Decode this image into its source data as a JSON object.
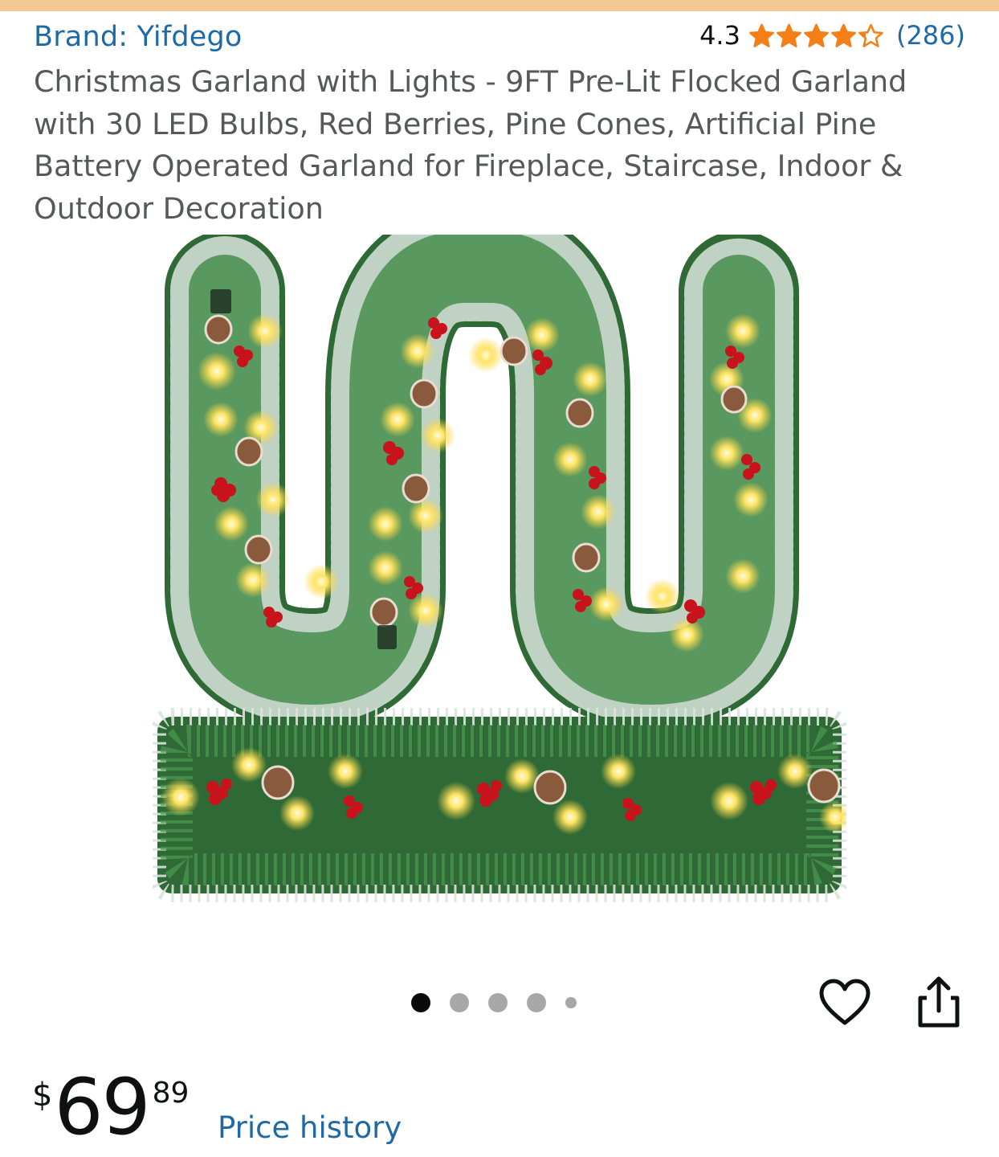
{
  "colors": {
    "link": "#1f6aa5",
    "title_text": "#565959",
    "star": "#f57f17",
    "top_bar": "#f3c892",
    "dot_active": "#0a0a0a",
    "dot_inactive": "#a7a7a7"
  },
  "product": {
    "brand_label": "Brand: Yifdego",
    "title": "Christmas Garland with Lights - 9FT Pre-Lit Flocked Garland with 30 LED Bulbs, Red Berries, Pine Cones, Artificial Pine Battery Operated Garland for Fireplace, Staircase, Indoor & Outdoor Decoration"
  },
  "rating": {
    "value": "4.3",
    "count": "(286)",
    "stars_out_of_5": 4.3
  },
  "gallery": {
    "image_count": 5,
    "active_index": 0
  },
  "icons": {
    "heart": "heart-icon",
    "share": "share-icon",
    "star": "star-icon"
  },
  "price": {
    "symbol": "$",
    "whole": "69",
    "fraction": "89"
  },
  "links": {
    "price_history": "Price history"
  }
}
